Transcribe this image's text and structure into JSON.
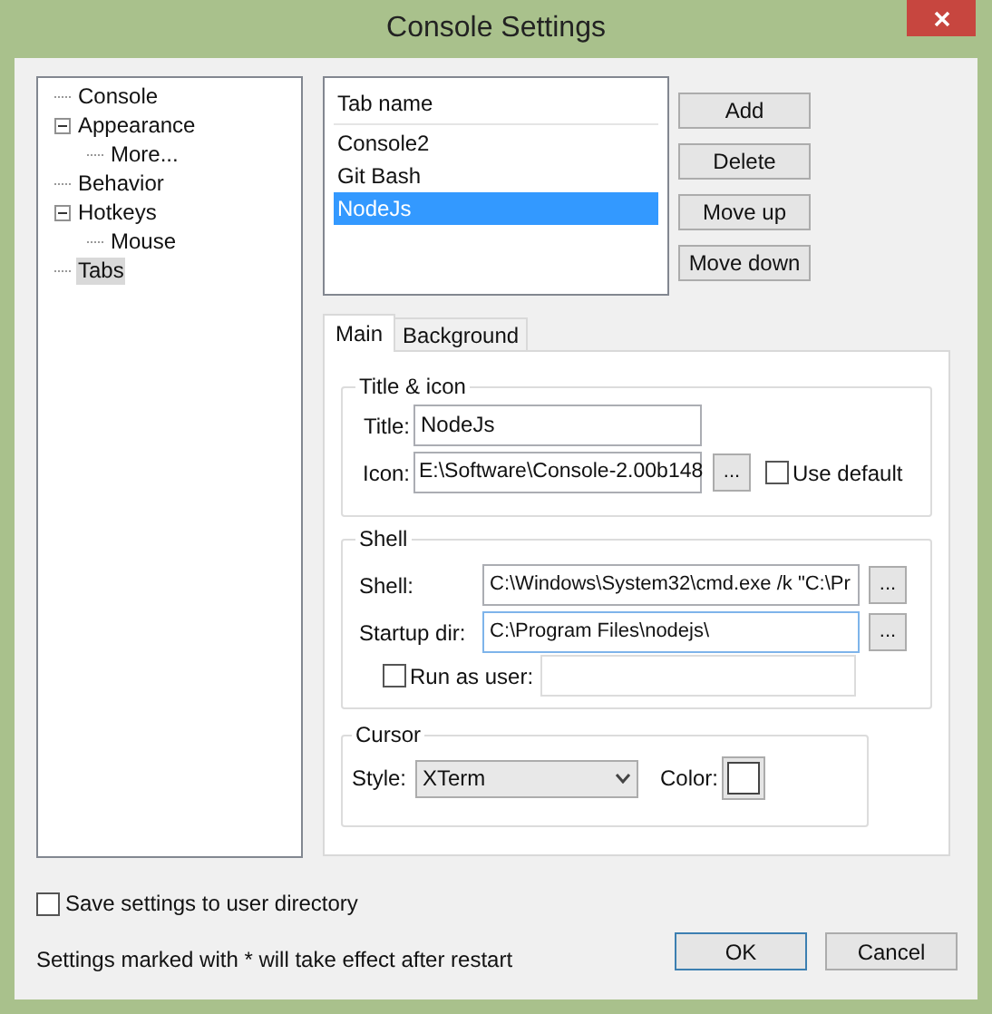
{
  "window": {
    "title": "Console Settings"
  },
  "tree": [
    {
      "label": "Console",
      "selected": false
    },
    {
      "label": "Appearance",
      "selected": false,
      "expanded": true,
      "children": [
        {
          "label": "More...",
          "selected": false
        }
      ]
    },
    {
      "label": "Behavior",
      "selected": false
    },
    {
      "label": "Hotkeys",
      "selected": false,
      "expanded": true,
      "children": [
        {
          "label": "Mouse",
          "selected": false
        }
      ]
    },
    {
      "label": "Tabs",
      "selected": true
    }
  ],
  "tab_list": {
    "column": "Tab name",
    "rows": [
      {
        "name": "Console2",
        "selected": false
      },
      {
        "name": "Git Bash",
        "selected": false
      },
      {
        "name": "NodeJs",
        "selected": true
      }
    ]
  },
  "list_buttons": [
    "Add",
    "Delete",
    "Move up",
    "Move down"
  ],
  "settings_tabs": [
    {
      "label": "Main",
      "selected": true
    },
    {
      "label": "Background",
      "selected": false
    }
  ],
  "title_icon": {
    "legend": "Title & icon",
    "title": {
      "label": "Title:",
      "value": "NodeJs"
    },
    "icon": {
      "label": "Icon:",
      "value": "E:\\Software\\Console-2.00b148",
      "browse": "..."
    },
    "use_default": {
      "label": "Use default",
      "checked": false
    }
  },
  "shell": {
    "legend": "Shell",
    "shell": {
      "label": "Shell:",
      "value": "C:\\Windows\\System32\\cmd.exe /k \"C:\\Pr",
      "browse": "..."
    },
    "startup_dir": {
      "label": "Startup dir:",
      "value": "C:\\Program Files\\nodejs\\",
      "browse": "..."
    },
    "run_as_user": {
      "label": "Run as user:",
      "checked": false
    }
  },
  "cursor": {
    "legend": "Cursor",
    "style": {
      "label": "Style:",
      "value": "XTerm"
    },
    "color": {
      "label": "Color:",
      "color": "#ffffff"
    }
  },
  "save_to_user_dir": {
    "label": "Save settings to user directory",
    "checked": false
  },
  "note": "Settings marked with * will take effect after restart",
  "buttons": [
    {
      "label": "OK",
      "default": true
    },
    {
      "label": "Cancel",
      "default": false
    }
  ]
}
